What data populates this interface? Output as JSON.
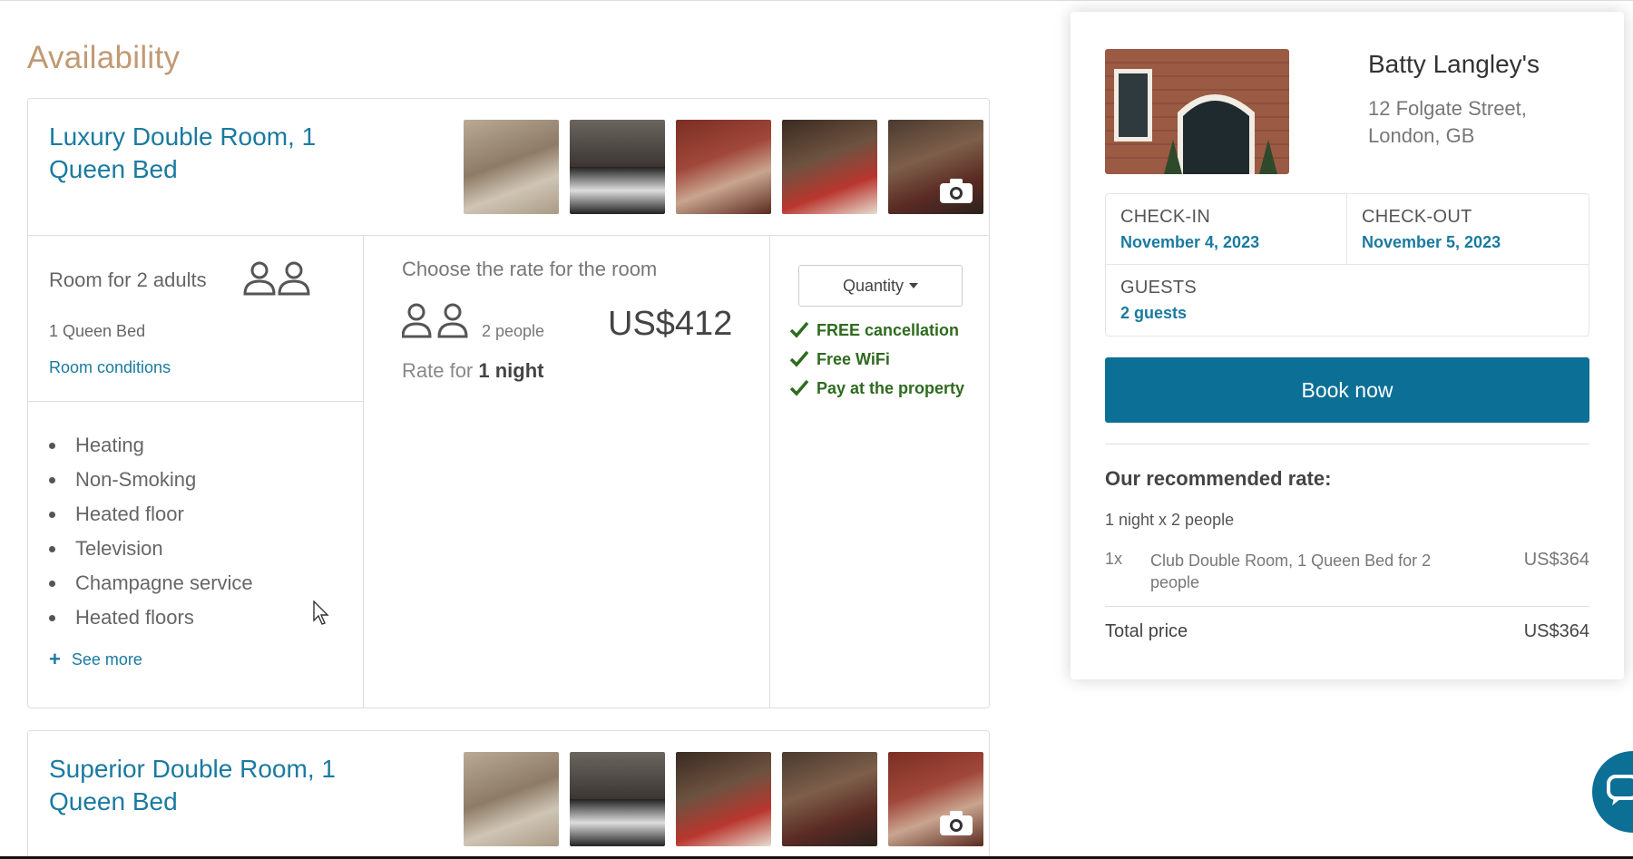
{
  "page": {
    "availability_title": "Availability"
  },
  "rooms": [
    {
      "title": "Luxury Double Room, 1 Queen Bed",
      "capacity": "Room for 2 adults",
      "bed": "1 Queen Bed",
      "conditions_link": "Room conditions",
      "amenities": [
        "Heating",
        "Non-Smoking",
        "Heated floor",
        "Television",
        "Champagne service",
        "Heated floors"
      ],
      "see_more": "See more",
      "choose_rate": "Choose the rate for the room",
      "people": "2 people",
      "price": "US$412",
      "rate_for_prefix": "Rate for",
      "rate_for_nights": "1 night",
      "quantity_label": "Quantity",
      "benefits": [
        "FREE cancellation",
        "Free WiFi",
        "Pay at the property"
      ]
    },
    {
      "title": "Superior Double Room, 1 Queen Bed"
    }
  ],
  "sidebar": {
    "hotel_name": "Batty Langley's",
    "address": "12 Folgate Street, London, GB",
    "check_in_label": "CHECK-IN",
    "check_in_date": "November 4, 2023",
    "check_out_label": "CHECK-OUT",
    "check_out_date": "November 5, 2023",
    "guests_label": "GUESTS",
    "guests_value": "2 guests",
    "book_button": "Book now",
    "recommended_title": "Our recommended rate:",
    "nights_people": "1 night x 2 people",
    "rec_qty": "1x",
    "rec_room": "Club Double Room, 1 Queen Bed for 2 people",
    "rec_price": "US$364",
    "total_label": "Total price",
    "total_price": "US$364"
  },
  "icons": {
    "people": "people-icon",
    "camera": "camera-icon",
    "check": "check-icon",
    "plus": "plus-icon",
    "caret": "caret-down-icon",
    "chat": "chat-icon"
  },
  "colors": {
    "link_blue": "#1a7aa0",
    "book_button": "#0b6f96",
    "benefit_green": "#2e6b1f",
    "availability_title": "#c19a74"
  }
}
